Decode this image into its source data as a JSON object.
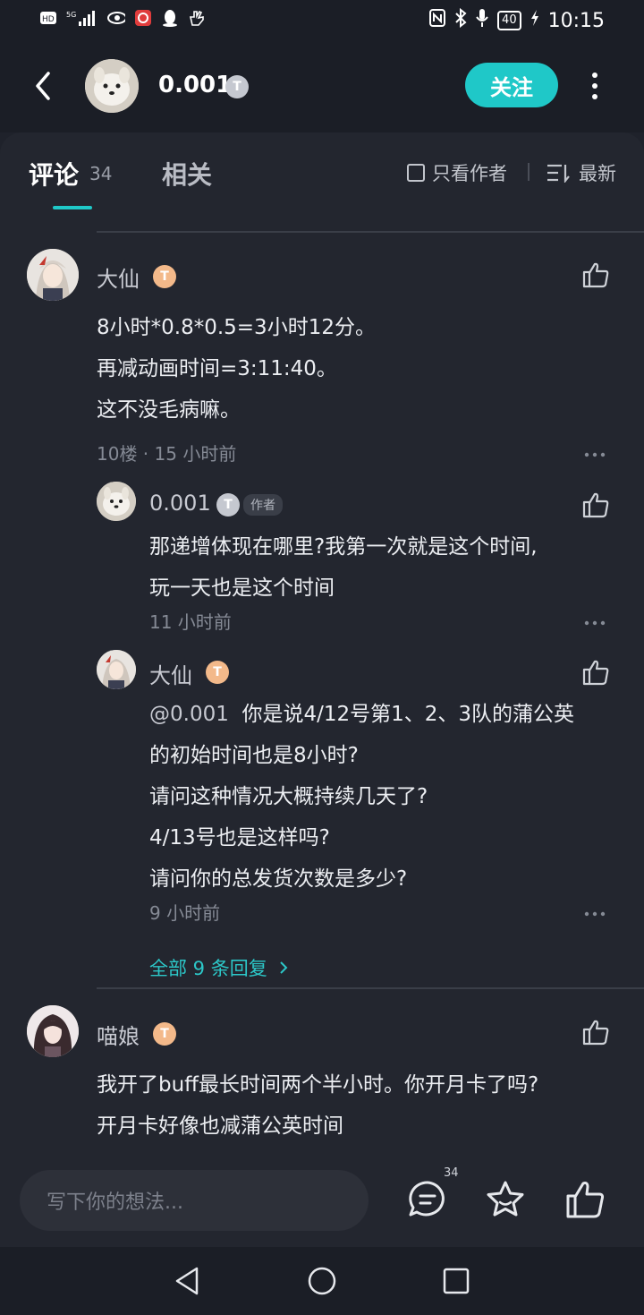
{
  "status": {
    "time": "10:15",
    "battery": "40",
    "network": "5G"
  },
  "header": {
    "name": "0.001",
    "level": "T",
    "follow_label": "关注"
  },
  "tabs": {
    "comments_label": "评论",
    "comments_count": "34",
    "related_label": "相关",
    "author_only_label": "只看作者",
    "sort_label": "最新"
  },
  "comments": [
    {
      "username": "大仙",
      "level": "T",
      "lines": [
        "8小时*0.8*0.5=3小时12分。",
        "再减动画时间=3:11:40。",
        "这不没毛病嘛。"
      ],
      "meta": "10楼 · 15 小时前",
      "replies": [
        {
          "username": "0.001",
          "level": "T",
          "author_tag": "作者",
          "lines": [
            "那递增体现在哪里?我第一次就是这个时间,",
            "玩一天也是这个时间"
          ],
          "time": "11 小时前"
        },
        {
          "username": "大仙",
          "level": "T",
          "mention": "@0.001",
          "lines": [
            "你是说4/12号第1、2、3队的蒲公英",
            "的初始时间也是8小时?",
            "请问这种情况大概持续几天了?",
            "4/13号也是这样吗?",
            "请问你的总发货次数是多少?"
          ],
          "time": "9 小时前"
        }
      ],
      "more_replies": "全部 9 条回复"
    },
    {
      "username": "喵娘",
      "level": "T",
      "lines": [
        "我开了buff最长时间两个半小时。你开月卡了吗?",
        "开月卡好像也减蒲公英时间"
      ]
    }
  ],
  "bottom": {
    "placeholder": "写下你的想法...",
    "comment_count": "34"
  },
  "colors": {
    "accent": "#1fc8c8",
    "background": "#23262f"
  }
}
